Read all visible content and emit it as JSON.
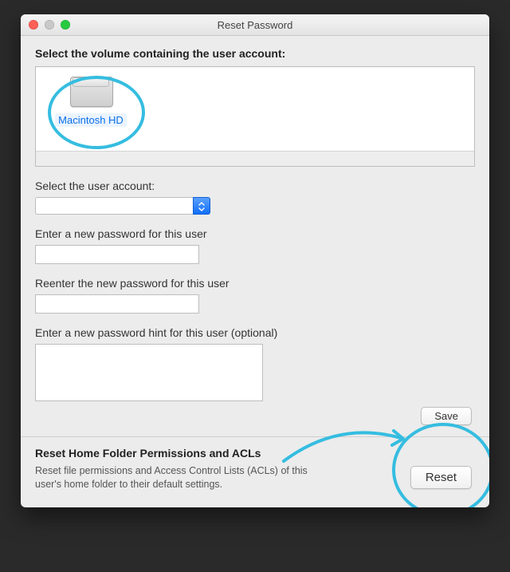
{
  "window": {
    "title": "Reset Password"
  },
  "volumeSection": {
    "label": "Select the volume containing the user account:",
    "selectedVolumeName": "Macintosh HD"
  },
  "userAccount": {
    "label": "Select the user account:",
    "selectedValue": ""
  },
  "newPassword": {
    "label": "Enter a new password for this user",
    "value": ""
  },
  "confirmPassword": {
    "label": "Reenter the new password for this user",
    "value": ""
  },
  "hint": {
    "label": "Enter a new password hint for this user (optional)",
    "value": ""
  },
  "buttons": {
    "save": "Save",
    "reset": "Reset"
  },
  "permissions": {
    "title": "Reset Home Folder Permissions and ACLs",
    "description": "Reset file permissions and Access Control Lists (ACLs) of this user's home folder to their default settings."
  },
  "annotation": {
    "highlightColor": "#35bde0"
  }
}
